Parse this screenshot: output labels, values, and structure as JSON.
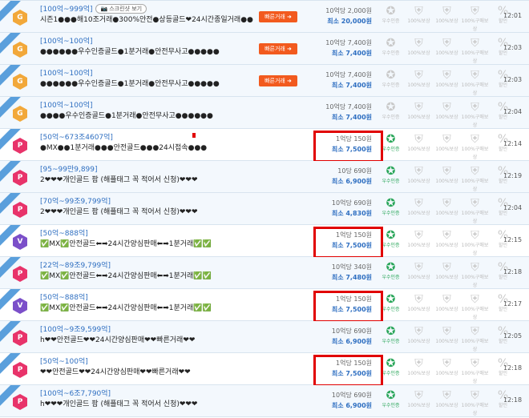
{
  "rows": [
    {
      "icon": "G",
      "title": "[100억~999억]",
      "has_shot": true,
      "shot_label": "스크린샷 보기",
      "desc": "시즌1●●●해10조거래●300%안전●상등골드❤24시간종일거래●●",
      "fast": "빠른거래 ➜",
      "rate": "10억당 2,000원",
      "min": "최소 20,000원",
      "badges": [
        false,
        false,
        false,
        false,
        false
      ],
      "time": "12:01"
    },
    {
      "icon": "G",
      "title": "[100억~100억]",
      "desc": "●●●●●●우수인증골드●1분거래●안전무사고●●●●●",
      "fast": "빠른거래 ➜",
      "rate": "10억당 7,400원",
      "min": "최소 7,400원",
      "badges": [
        false,
        false,
        false,
        false,
        false
      ],
      "time": "12:03"
    },
    {
      "icon": "G",
      "title": "[100억~100억]",
      "desc": "●●●●●●우수인증골드●1분거래●안전무사고●●●●●",
      "fast": "빠른거래 ➜",
      "rate": "10억당 7,400원",
      "min": "최소 7,400원",
      "badges": [
        false,
        false,
        false,
        false,
        false
      ],
      "time": "12:03"
    },
    {
      "icon": "G",
      "title": "[100억~100억]",
      "desc": "●●●●우수인증골드●1분거래●안전무사고●●●●●●",
      "rate": "10억당 7,400원",
      "min": "최소 7,400원",
      "badges": [
        false,
        false,
        false,
        false,
        false
      ],
      "time": "12:04"
    },
    {
      "icon": "P",
      "title": "[50억~673조4607억]",
      "desc": "●MX●●1분거래●●●안전골드●●●24시접속●●●",
      "rate": "1억당 150원",
      "min": "최소 7,500원",
      "badges": [
        true,
        false,
        false,
        false,
        false
      ],
      "time": "12:14",
      "red": true,
      "dot": true
    },
    {
      "icon": "P",
      "title": "[95~99만9,899]",
      "desc": "2❤❤❤개인골드 팜 (해플태그 꼭 적어서 신청)❤❤❤",
      "rate": "10당 690원",
      "min": "최소 6,900원",
      "badges": [
        true,
        false,
        false,
        false,
        false
      ],
      "time": "12:19"
    },
    {
      "icon": "P",
      "title": "[70억~99조9,799억]",
      "desc": "2❤❤❤개인골드 팜 (해플태그 꼭 적어서 신청)❤❤❤",
      "rate": "10억당 690원",
      "min": "최소 4,830원",
      "badges": [
        true,
        false,
        false,
        false,
        false
      ],
      "time": "12:04"
    },
    {
      "icon": "V",
      "title": "[50억~888억]",
      "desc": "✅MX✅안전골드⬅➡24시간양심판매⬅➡1분거래✅✅",
      "rate": "1억당 150원",
      "min": "최소 7,500원",
      "badges": [
        true,
        false,
        false,
        false,
        false
      ],
      "time": "12:15",
      "red": true
    },
    {
      "icon": "P",
      "title": "[22억~89조9,799억]",
      "desc": "✅MX✅안전골드⬅➡24시간양심판매⬅➡1분거래✅✅",
      "rate": "10억당 340원",
      "min": "최소 7,480원",
      "badges": [
        true,
        false,
        false,
        false,
        false
      ],
      "time": "12:18"
    },
    {
      "icon": "V",
      "title": "[50억~888억]",
      "desc": "✅MX✅안전골드⬅➡24시간양심판매⬅➡1분거래✅✅",
      "rate": "1억당 150원",
      "min": "최소 7,500원",
      "badges": [
        true,
        false,
        false,
        false,
        false
      ],
      "time": "12:17",
      "red": true
    },
    {
      "icon": "P",
      "title": "[100억~9조9,599억]",
      "desc": "h❤❤안전골드❤❤24시간양심판매❤❤빠른거래❤❤",
      "rate": "10억당 690원",
      "min": "최소 6,900원",
      "badges": [
        true,
        false,
        false,
        false,
        false
      ],
      "time": "12:05"
    },
    {
      "icon": "P",
      "title": "[50억~100억]",
      "desc": "❤❤안전골드❤❤24시간양심판매❤❤빠른거래❤❤",
      "rate": "1억당 150원",
      "min": "최소 7,500원",
      "badges": [
        true,
        false,
        false,
        false,
        false
      ],
      "time": "12:18",
      "red": true
    },
    {
      "icon": "P",
      "title": "[100억~6조7,790억]",
      "desc": "h❤❤❤개인골드 팜 (해플태그 꼭 적어서 신청)❤❤❤",
      "rate": "10억당 690원",
      "min": "최소 6,900원",
      "badges": [
        true,
        false,
        false,
        false,
        false
      ],
      "time": "12:18"
    }
  ],
  "ribbon_label": "Premium",
  "badge_labels": [
    "우수인증",
    "100%보상",
    "100%보상",
    "100%구매보상",
    "할인"
  ],
  "badge_icons": [
    "ribbon-icon",
    "shield-icon",
    "shield-icon",
    "shield-icon",
    "tag-icon"
  ],
  "colors": {
    "accent": "#2f6fc1",
    "premium": "#5a9fdc",
    "fast": "#f25a1e",
    "highlight": "#e10000",
    "verified": "#2aa65a"
  }
}
